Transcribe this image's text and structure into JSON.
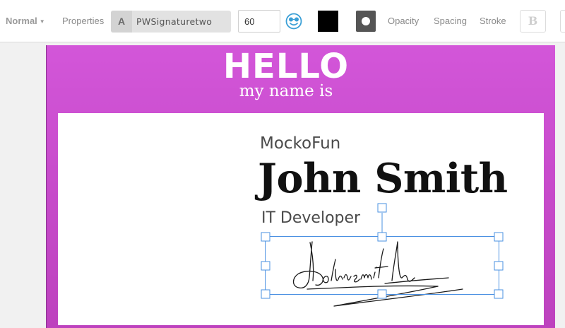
{
  "toolbar": {
    "blend_mode": "Normal",
    "properties_label": "Properties",
    "font_icon": "A",
    "font_name": "PWSignaturetwo",
    "font_size": "60",
    "emoji_icon": "smiley-icon",
    "text_color": "#000000",
    "stroke_color": "#555555",
    "opacity_label": "Opacity",
    "spacing_label": "Spacing",
    "stroke_label": "Stroke",
    "bold_label": "B"
  },
  "badge": {
    "background_color": "#cd50d2",
    "hello": "HELLO",
    "subtitle": "my name is"
  },
  "card": {
    "company": "MockoFun",
    "name": "John Smith",
    "role": "IT Developer",
    "signature_text": "Johnsmith"
  }
}
